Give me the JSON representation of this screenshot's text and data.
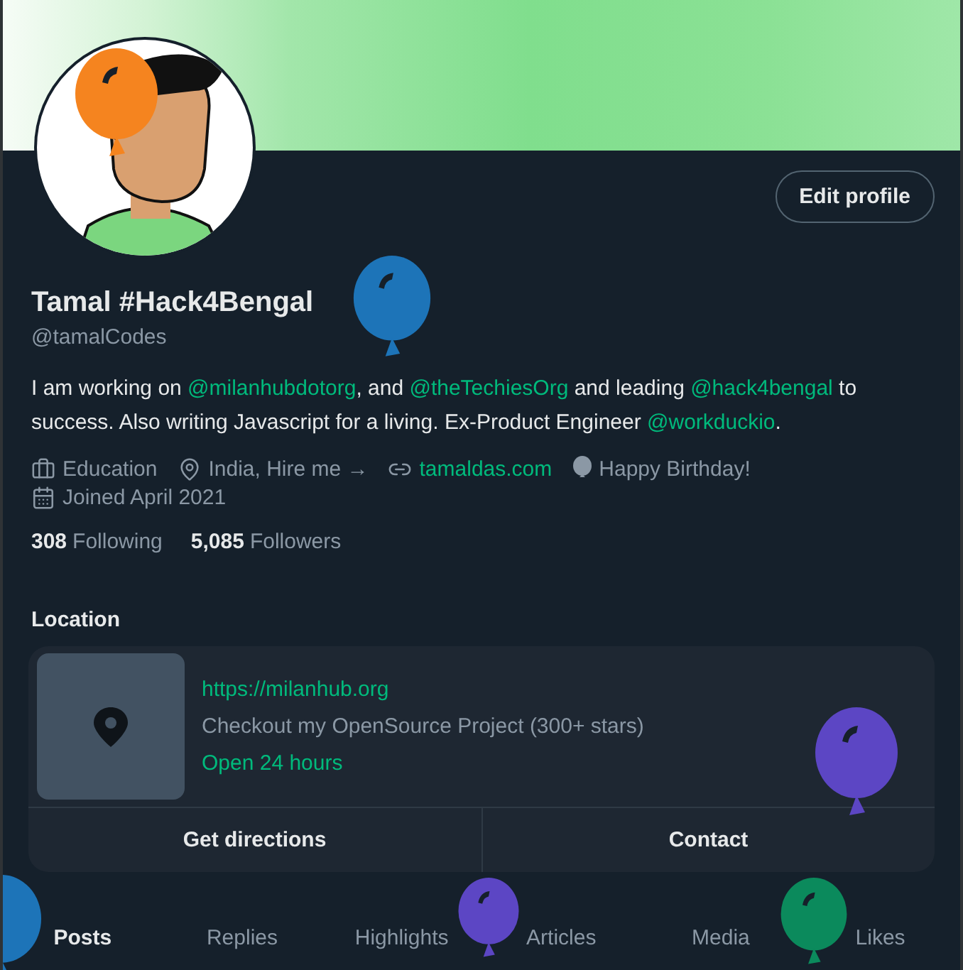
{
  "profile": {
    "name": "Tamal #Hack4Bengal",
    "handle": "@tamalCodes",
    "edit_button": "Edit profile",
    "bio": [
      {
        "kind": "text",
        "text": "I am working on "
      },
      {
        "kind": "mention",
        "text": "@milanhubdotorg"
      },
      {
        "kind": "text",
        "text": ", and "
      },
      {
        "kind": "mention",
        "text": "@theTechiesOrg"
      },
      {
        "kind": "text",
        "text": " and leading "
      },
      {
        "kind": "mention",
        "text": "@hack4bengal"
      },
      {
        "kind": "text",
        "text": " to success. Also writing Javascript for a living. Ex-Product Engineer "
      },
      {
        "kind": "mention",
        "text": "@workduckio"
      },
      {
        "kind": "text",
        "text": "."
      }
    ],
    "meta": [
      {
        "kind": "text",
        "text": "Education"
      },
      {
        "kind": "text",
        "text": "India, Hire me →"
      },
      {
        "kind": "link",
        "text": "tamaldas.com"
      },
      {
        "kind": "text",
        "text": "Happy Birthday!"
      },
      {
        "kind": "text",
        "text": "Joined April 2021"
      }
    ],
    "stats": [
      {
        "count": "308",
        "label": "Following"
      },
      {
        "count": "5,085",
        "label": "Followers"
      }
    ]
  },
  "location": {
    "heading": "Location",
    "url": "https://milanhub.org",
    "description": "Checkout my OpenSource Project (300+ stars)",
    "hours": "Open 24 hours",
    "actions": [
      "Get directions",
      "Contact"
    ]
  },
  "tabs": [
    {
      "label": "Posts",
      "selected": true
    },
    {
      "label": "Replies",
      "selected": false
    },
    {
      "label": "Highlights",
      "selected": false
    },
    {
      "label": "Articles",
      "selected": false
    },
    {
      "label": "Media",
      "selected": false
    },
    {
      "label": "Likes",
      "selected": false
    }
  ],
  "balloons": [
    {
      "color": "#f5841f"
    },
    {
      "color": "#1d74b8"
    },
    {
      "color": "#5c46c4"
    },
    {
      "color": "#1d74b8"
    },
    {
      "color": "#5c46c4"
    },
    {
      "color": "#0b8a5c"
    }
  ]
}
